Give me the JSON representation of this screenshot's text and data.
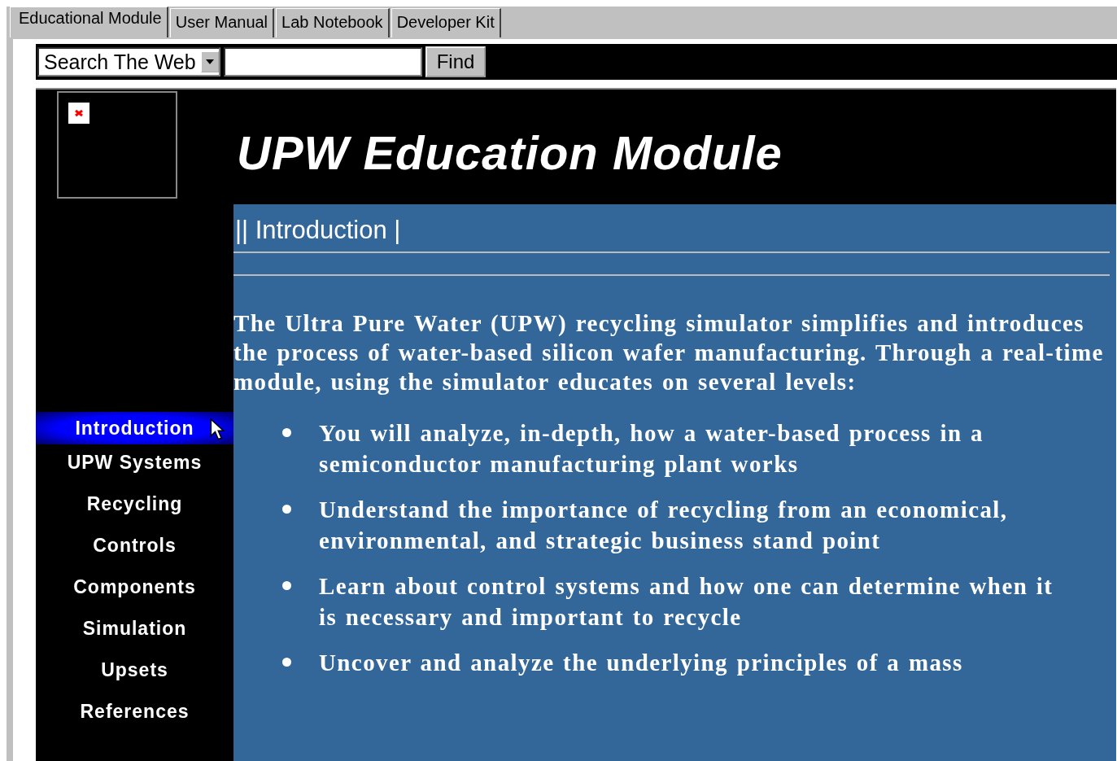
{
  "tabs": [
    {
      "label": "Educational Module",
      "selected": true
    },
    {
      "label": "User Manual",
      "selected": false
    },
    {
      "label": "Lab Notebook",
      "selected": false
    },
    {
      "label": "Developer Kit",
      "selected": false
    }
  ],
  "search": {
    "scope": "Search The Web",
    "button": "Find"
  },
  "header": {
    "title": "UPW Education Module",
    "section": "|| Introduction |"
  },
  "sidebar": {
    "items": [
      {
        "label": "Introduction",
        "selected": true
      },
      {
        "label": "UPW Systems",
        "selected": false
      },
      {
        "label": "Recycling",
        "selected": false
      },
      {
        "label": "Controls",
        "selected": false
      },
      {
        "label": "Components",
        "selected": false
      },
      {
        "label": "Simulation",
        "selected": false
      },
      {
        "label": "Upsets",
        "selected": false
      },
      {
        "label": "References",
        "selected": false
      }
    ]
  },
  "content": {
    "intro": "The Ultra Pure Water (UPW) recycling simulator simplifies and introduces the process of water-based silicon wafer manufacturing. Through a real-time module, using the simulator educates on several levels:",
    "bullets": [
      "You will analyze, in-depth, how a water-based process in a semiconductor manufacturing plant works",
      "Understand the importance of recycling from an economical, environmental, and strategic business stand point",
      "Learn about control systems and how one can determine when it is necessary and important to recycle",
      "Uncover and analyze the underlying principles of a mass"
    ]
  }
}
